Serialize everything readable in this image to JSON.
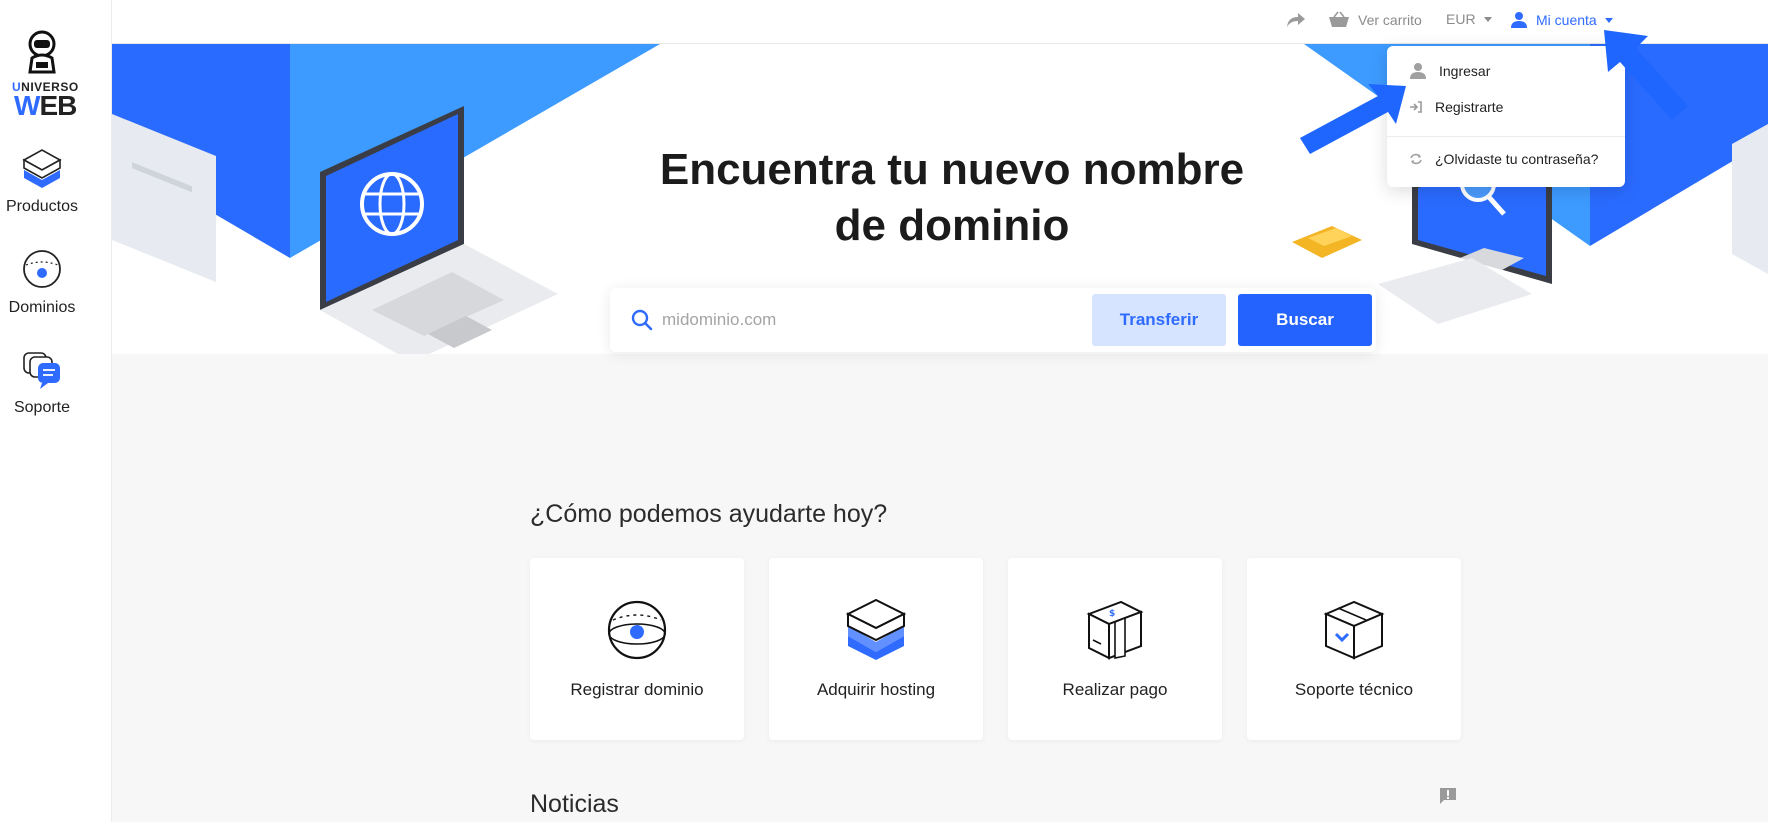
{
  "brand": {
    "line1": "NIVERSO",
    "line1_first": "U",
    "line2_first": "W",
    "line2": "EB"
  },
  "sidebar": {
    "items": [
      {
        "label": "Productos",
        "icon": "box-stack-icon"
      },
      {
        "label": "Dominios",
        "icon": "globe-icon"
      },
      {
        "label": "Soporte",
        "icon": "chat-bubbles-icon"
      }
    ]
  },
  "topbar": {
    "cart_label": "Ver carrito",
    "currency_label": "EUR",
    "account_label": "Mi cuenta"
  },
  "account_menu": {
    "items": [
      {
        "label": "Ingresar",
        "icon": "user-icon"
      },
      {
        "label": "Registrarte",
        "icon": "sign-in-icon"
      },
      {
        "label": "¿Olvidaste tu contraseña?",
        "icon": "refresh-icon"
      }
    ]
  },
  "hero": {
    "title": "Encuentra tu nuevo nombre de dominio",
    "search_placeholder": "midominio.com",
    "transfer_label": "Transferir",
    "search_label": "Buscar"
  },
  "help": {
    "title": "¿Cómo podemos ayudarte hoy?",
    "cards": [
      {
        "label": "Registrar dominio",
        "icon": "globe-icon"
      },
      {
        "label": "Adquirir hosting",
        "icon": "hosting-box-icon"
      },
      {
        "label": "Realizar pago",
        "icon": "payment-package-icon"
      },
      {
        "label": "Soporte técnico",
        "icon": "support-package-icon"
      }
    ]
  },
  "news": {
    "title": "Noticias"
  },
  "colors": {
    "accent": "#2563ff",
    "accent_light": "#d6e4ff",
    "hero_blue": "#3d8bff"
  }
}
